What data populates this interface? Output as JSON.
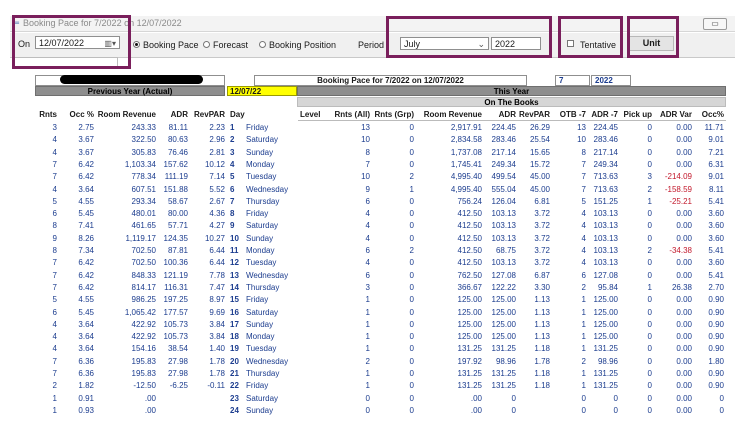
{
  "window": {
    "title": "Booking Pace for 7/2022 on 12/07/2022",
    "btn_min": "▭",
    "btn_close": "✕"
  },
  "controls": {
    "on_label": "On",
    "on_date": "12/07/2022",
    "radio_booking_pace": "Booking Pace",
    "radio_forecast": "Forecast",
    "radio_booking_position": "Booking Position",
    "period_label": "Period",
    "period_month": "July",
    "period_year": "2022",
    "tentative_label": "Tentative",
    "unit_label": "Unit"
  },
  "report_header": {
    "center_title": "Booking Pace for 7/2022 on 12/07/2022",
    "month_num": "7",
    "year": "2022",
    "previous_year": "Previous Year (Actual)",
    "date_tag": "12/07/22",
    "this_year": "This Year",
    "on_the_books": "On The Books"
  },
  "columns": {
    "rnts": "Rnts",
    "occ": "Occ %",
    "room_revenue": "Room Revenue",
    "adr": "ADR",
    "revpar": "RevPAR",
    "day": "Day",
    "level": "Level",
    "rnts_all": "Rnts (All)",
    "rnts_grp": "Rnts (Grp)",
    "room_revenue2": "Room Revenue",
    "adr2": "ADR",
    "revpar2": "RevPAR",
    "otb7": "OTB -7",
    "adr7": "ADR -7",
    "pickup": "Pick up",
    "adrvar": "ADR Var",
    "occ2": "Occ%"
  },
  "rows": [
    {
      "py": [
        "3",
        "2.75",
        "243.33",
        "81.11",
        "2.23"
      ],
      "d": "1",
      "dn": "Friday",
      "ty": [
        "13",
        "0",
        "2,917.91",
        "224.45",
        "26.29",
        "13",
        "224.45",
        "0",
        "0.00",
        "11.71"
      ]
    },
    {
      "py": [
        "4",
        "3.67",
        "322.50",
        "80.63",
        "2.96"
      ],
      "d": "2",
      "dn": "Saturday",
      "ty": [
        "10",
        "0",
        "2,834.58",
        "283.46",
        "25.54",
        "10",
        "283.46",
        "0",
        "0.00",
        "9.01"
      ]
    },
    {
      "py": [
        "4",
        "3.67",
        "305.83",
        "76.46",
        "2.81"
      ],
      "d": "3",
      "dn": "Sunday",
      "ty": [
        "8",
        "0",
        "1,737.08",
        "217.14",
        "15.65",
        "8",
        "217.14",
        "0",
        "0.00",
        "7.21"
      ]
    },
    {
      "py": [
        "7",
        "6.42",
        "1,103.34",
        "157.62",
        "10.12"
      ],
      "d": "4",
      "dn": "Monday",
      "ty": [
        "7",
        "0",
        "1,745.41",
        "249.34",
        "15.72",
        "7",
        "249.34",
        "0",
        "0.00",
        "6.31"
      ]
    },
    {
      "py": [
        "7",
        "6.42",
        "778.34",
        "111.19",
        "7.14"
      ],
      "d": "5",
      "dn": "Tuesday",
      "ty": [
        "10",
        "2",
        "4,995.40",
        "499.54",
        "45.00",
        "7",
        "713.63",
        "3",
        "-214.09",
        "9.01"
      ]
    },
    {
      "py": [
        "4",
        "3.64",
        "607.51",
        "151.88",
        "5.52"
      ],
      "d": "6",
      "dn": "Wednesday",
      "ty": [
        "9",
        "1",
        "4,995.40",
        "555.04",
        "45.00",
        "7",
        "713.63",
        "2",
        "-158.59",
        "8.11"
      ]
    },
    {
      "py": [
        "5",
        "4.55",
        "293.34",
        "58.67",
        "2.67"
      ],
      "d": "7",
      "dn": "Thursday",
      "ty": [
        "6",
        "0",
        "756.24",
        "126.04",
        "6.81",
        "5",
        "151.25",
        "1",
        "-25.21",
        "5.41"
      ]
    },
    {
      "py": [
        "6",
        "5.45",
        "480.01",
        "80.00",
        "4.36"
      ],
      "d": "8",
      "dn": "Friday",
      "ty": [
        "4",
        "0",
        "412.50",
        "103.13",
        "3.72",
        "4",
        "103.13",
        "0",
        "0.00",
        "3.60"
      ]
    },
    {
      "py": [
        "8",
        "7.41",
        "461.65",
        "57.71",
        "4.27"
      ],
      "d": "9",
      "dn": "Saturday",
      "ty": [
        "4",
        "0",
        "412.50",
        "103.13",
        "3.72",
        "4",
        "103.13",
        "0",
        "0.00",
        "3.60"
      ]
    },
    {
      "py": [
        "9",
        "8.26",
        "1,119.17",
        "124.35",
        "10.27"
      ],
      "d": "10",
      "dn": "Sunday",
      "ty": [
        "4",
        "0",
        "412.50",
        "103.13",
        "3.72",
        "4",
        "103.13",
        "0",
        "0.00",
        "3.60"
      ]
    },
    {
      "py": [
        "8",
        "7.34",
        "702.50",
        "87.81",
        "6.44"
      ],
      "d": "11",
      "dn": "Monday",
      "ty": [
        "6",
        "2",
        "412.50",
        "68.75",
        "3.72",
        "4",
        "103.13",
        "2",
        "-34.38",
        "5.41"
      ]
    },
    {
      "py": [
        "7",
        "6.42",
        "702.50",
        "100.36",
        "6.44"
      ],
      "d": "12",
      "dn": "Tuesday",
      "ty": [
        "4",
        "0",
        "412.50",
        "103.13",
        "3.72",
        "4",
        "103.13",
        "0",
        "0.00",
        "3.60"
      ]
    },
    {
      "py": [
        "7",
        "6.42",
        "848.33",
        "121.19",
        "7.78"
      ],
      "d": "13",
      "dn": "Wednesday",
      "ty": [
        "6",
        "0",
        "762.50",
        "127.08",
        "6.87",
        "6",
        "127.08",
        "0",
        "0.00",
        "5.41"
      ]
    },
    {
      "py": [
        "7",
        "6.42",
        "814.17",
        "116.31",
        "7.47"
      ],
      "d": "14",
      "dn": "Thursday",
      "ty": [
        "3",
        "0",
        "366.67",
        "122.22",
        "3.30",
        "2",
        "95.84",
        "1",
        "26.38",
        "2.70"
      ]
    },
    {
      "py": [
        "5",
        "4.55",
        "986.25",
        "197.25",
        "8.97"
      ],
      "d": "15",
      "dn": "Friday",
      "ty": [
        "1",
        "0",
        "125.00",
        "125.00",
        "1.13",
        "1",
        "125.00",
        "0",
        "0.00",
        "0.90"
      ]
    },
    {
      "py": [
        "6",
        "5.45",
        "1,065.42",
        "177.57",
        "9.69"
      ],
      "d": "16",
      "dn": "Saturday",
      "ty": [
        "1",
        "0",
        "125.00",
        "125.00",
        "1.13",
        "1",
        "125.00",
        "0",
        "0.00",
        "0.90"
      ]
    },
    {
      "py": [
        "4",
        "3.64",
        "422.92",
        "105.73",
        "3.84"
      ],
      "d": "17",
      "dn": "Sunday",
      "ty": [
        "1",
        "0",
        "125.00",
        "125.00",
        "1.13",
        "1",
        "125.00",
        "0",
        "0.00",
        "0.90"
      ]
    },
    {
      "py": [
        "4",
        "3.64",
        "422.92",
        "105.73",
        "3.84"
      ],
      "d": "18",
      "dn": "Monday",
      "ty": [
        "1",
        "0",
        "125.00",
        "125.00",
        "1.13",
        "1",
        "125.00",
        "0",
        "0.00",
        "0.90"
      ]
    },
    {
      "py": [
        "4",
        "3.64",
        "154.16",
        "38.54",
        "1.40"
      ],
      "d": "19",
      "dn": "Tuesday",
      "ty": [
        "1",
        "0",
        "131.25",
        "131.25",
        "1.18",
        "1",
        "131.25",
        "0",
        "0.00",
        "0.90"
      ]
    },
    {
      "py": [
        "7",
        "6.36",
        "195.83",
        "27.98",
        "1.78"
      ],
      "d": "20",
      "dn": "Wednesday",
      "ty": [
        "2",
        "0",
        "197.92",
        "98.96",
        "1.78",
        "2",
        "98.96",
        "0",
        "0.00",
        "1.80"
      ]
    },
    {
      "py": [
        "7",
        "6.36",
        "195.83",
        "27.98",
        "1.78"
      ],
      "d": "21",
      "dn": "Thursday",
      "ty": [
        "1",
        "0",
        "131.25",
        "131.25",
        "1.18",
        "1",
        "131.25",
        "0",
        "0.00",
        "0.90"
      ]
    },
    {
      "py": [
        "2",
        "1.82",
        "-12.50",
        "-6.25",
        "-0.11"
      ],
      "d": "22",
      "dn": "Friday",
      "ty": [
        "1",
        "0",
        "131.25",
        "131.25",
        "1.18",
        "1",
        "131.25",
        "0",
        "0.00",
        "0.90"
      ]
    },
    {
      "py": [
        "1",
        "0.91",
        ".00",
        "",
        ""
      ],
      "d": "23",
      "dn": "Saturday",
      "ty": [
        "0",
        "0",
        ".00",
        "0",
        "",
        "0",
        "0",
        "0",
        "0.00",
        "0"
      ]
    },
    {
      "py": [
        "1",
        "0.93",
        ".00",
        "",
        ""
      ],
      "d": "24",
      "dn": "Sunday",
      "ty": [
        "0",
        "0",
        ".00",
        "0",
        "",
        "0",
        "0",
        "0",
        "0.00",
        "0"
      ]
    }
  ]
}
